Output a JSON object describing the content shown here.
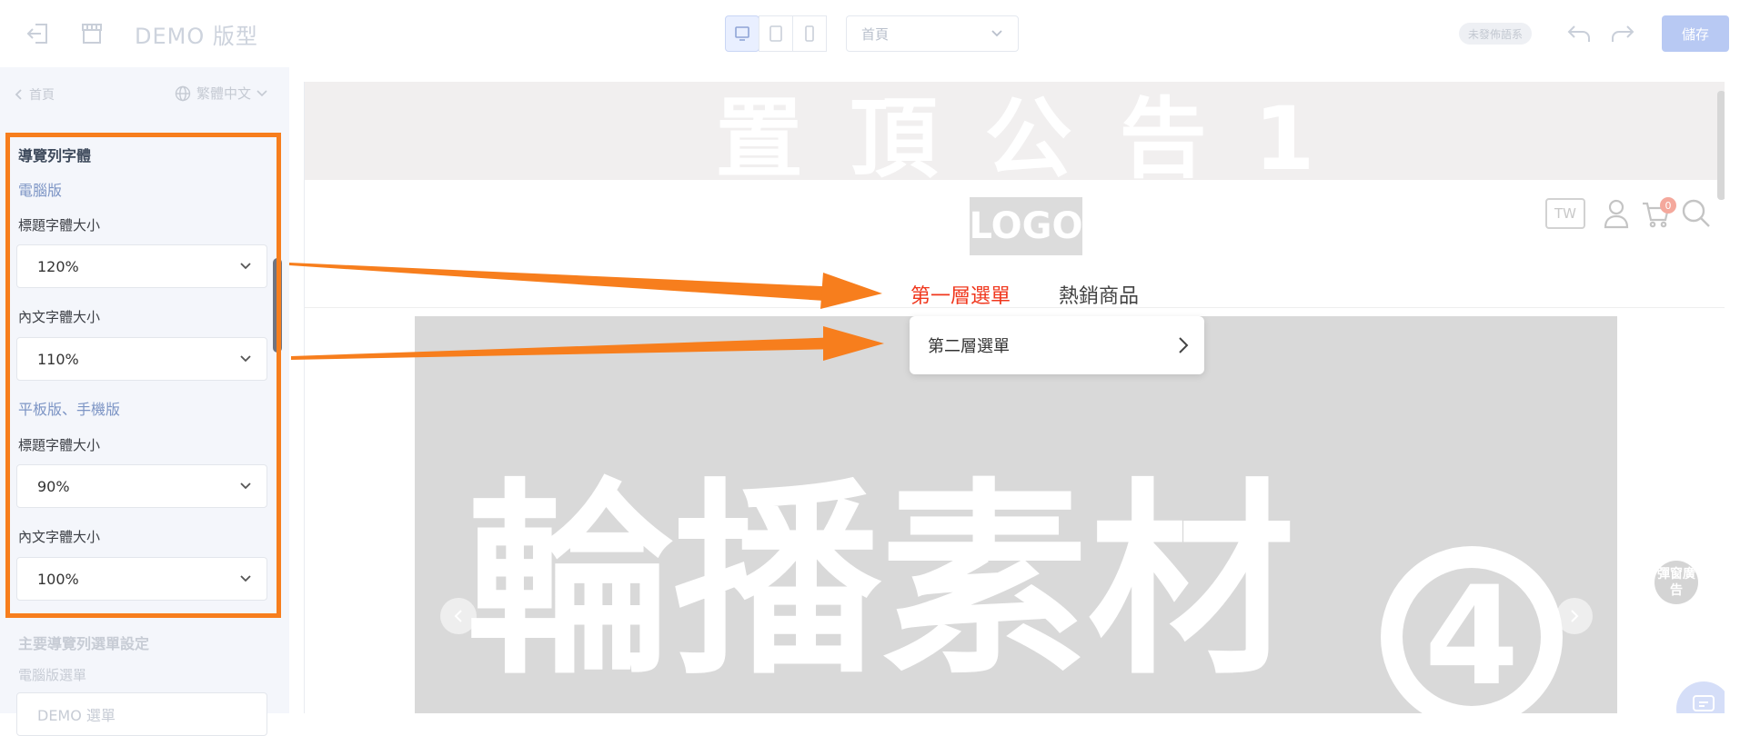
{
  "topbar": {
    "title": "DEMO 版型",
    "page_select": "首頁",
    "status_badge": "未發佈語系",
    "save_label": "儲存"
  },
  "sidebar": {
    "back_label": "首頁",
    "language": "繁體中文",
    "section_title": "導覽列字體",
    "desktop_label": "電腦版",
    "desktop_title_label": "標題字體大小",
    "desktop_title_value": "120%",
    "desktop_body_label": "內文字體大小",
    "desktop_body_value": "110%",
    "mobile_label": "平板版、手機版",
    "mobile_title_label": "標題字體大小",
    "mobile_title_value": "90%",
    "mobile_body_label": "內文字體大小",
    "mobile_body_value": "100%",
    "next_section_title": "主要導覽列選單設定",
    "next_sub_label": "電腦版選單",
    "next_select_value": "DEMO 選單"
  },
  "preview": {
    "announcement": "置頂公告1",
    "logo": "LOGO",
    "lang_badge": "TW",
    "cart_count": "0",
    "nav_items": [
      "第一層選單",
      "熱銷商品"
    ],
    "dropdown_item": "第二層選單",
    "carousel_text": "輪播素材",
    "carousel_num": "4",
    "popup_ad": "彈窗廣告"
  },
  "colors": {
    "highlight": "#f77e1d",
    "nav_active": "#f0371d",
    "save_button": "#b8c9f3"
  }
}
